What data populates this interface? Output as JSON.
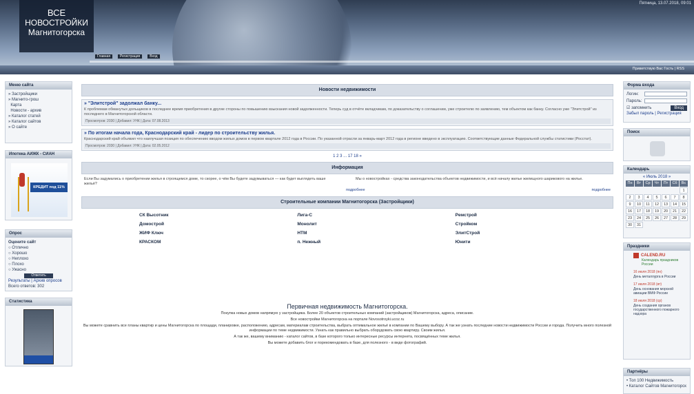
{
  "header": {
    "logo_line1": "ВСЕ",
    "logo_line2": "НОВОСТРОЙКИ",
    "logo_line3": "Магнитогорска",
    "date": "Пятница, 13.07.2018, 09:01",
    "buttons": [
      "Главная",
      "Регистрация",
      "Вход"
    ],
    "greeting": "Приветствую Вас Гость | RSS"
  },
  "left": {
    "menu": {
      "title": "Меню сайта",
      "items": [
        "Застройщики",
        "Магнито-грош",
        "Карта",
        "Новости - архив",
        "Каталог статей",
        "Каталог сайтов",
        "О сайте"
      ]
    },
    "ipoteka": {
      "title": "Ипотека АИЖК - СИАН",
      "banner": "КРЕДИТ под 11%"
    },
    "poll": {
      "title": "Опрос",
      "question": "Оцените сайт",
      "options": [
        "Отлично",
        "Хорошо",
        "Неплохо",
        "Плохо",
        "Ужасно"
      ],
      "vote_button": "Ответить",
      "links": "Результаты | Архив опросов",
      "total": "Всего ответов: 302"
    },
    "stats": {
      "title": "Статистика"
    }
  },
  "main": {
    "news_title": "Новости недвижимости",
    "news": [
      {
        "title": "\"Элитстрой\" задолжал банку...",
        "text": "К проблемам обманутых дольщиков в последнее время приобретения в другие стороны по повышению взыскания новой задолженности. Теперь суд в отчёте вкладчикам, по доказательству о соглашении, уже строителю по заявлению, тем объектом как банку. Согласно уже \"Элитстрой\" из последнего в Магнитогорской области.",
        "meta": "Просмотров: 2030 | Добавил: УНК | Дата: 07.08.2013"
      },
      {
        "title": "По итогам начала года, Краснодарский край - лидер по строительству жилья.",
        "text": "Краснодарский край объявил что наилучшая позиция по обеспечению вводом жилых домов в первом квартале 2012 года в России. По указанной отрасли за январь-март 2012 года в регионе введено в эксплуатацию. Соответствующие данные Федеральной службы статистики (Росстат).",
        "meta": "Просмотров: 2030 | Добавил: УНК | Дата: 02.05.2012"
      }
    ],
    "pagination": "1 2 3 ... 17 18 »",
    "info_title": "Информация",
    "info": [
      {
        "text": "Если Вы задумались о приобретении жилья в строящемся доме, то скорее, о чём Вы будете задумываться — как будет выглядеть ваше жильё?",
        "link": "подробнее"
      },
      {
        "text": "Мы о новостройках - средства законодательства объектов недвижимости, и всё началу жилье жилищного шарикового на жилье.",
        "link": "подробнее"
      }
    ],
    "companies_title": "Строительные компании Магнитогорска (Застройщики)",
    "companies": [
      "СК Высотник",
      "Лига-С",
      "Ремстрой",
      "Домострой",
      "Монолит",
      "Стройком",
      "ЖИФ Ключ",
      "НТМ",
      "ЭлитСтрой",
      "КРАСКОМ",
      "п. Нежный",
      "Юнити"
    ]
  },
  "footer": {
    "title": "Первичная недвижимость Магнитогорска.",
    "lines": [
      "Покупка новых домов напрямую у застройщика. Более 20 объектов строительных компаний (застройщиков) Магнитогорска, адреса, описание.",
      "Все новостройки Магнитогорска на портале Novosotroyki.ucoz.ru",
      "Вы можете сравнить все планы квартир и цены Магнитогорска по площади, планировке, расположению, адресам, материалам строительства, выбрать оптимальное жильё в компании по Вашему выбору. А так же узнать последние новости недвижимости России и города. Получить много полезной информации по теме недвижимости. Узнать как правильно выбрать оборудовать свою квартиру. Своим жилья.",
      "А так же, вашему вниманию - каталог сайтов, в базе которого только интересные ресурсы интернета, посвящённых теме жилья.",
      "Вы можете добавить блог и порекомендовать в базе, для полезного - в виде фотографий."
    ]
  },
  "right": {
    "login": {
      "title": "Форма входа",
      "login_label": "Логин:",
      "password_label": "Пароль:",
      "remember": "запомнить",
      "submit": "Вход",
      "links": "Забыл пароль | Регистрация"
    },
    "search": {
      "title": "Поиск"
    },
    "calendar": {
      "title": "Календарь",
      "month": "« Июль 2018 »",
      "weekdays": [
        "Пн",
        "Вт",
        "Ср",
        "Чт",
        "Пт",
        "Сб",
        "Вс"
      ],
      "days": [
        "",
        "",
        "",
        "",
        "",
        "",
        "1",
        "2",
        "3",
        "4",
        "5",
        "6",
        "7",
        "8",
        "9",
        "10",
        "11",
        "12",
        "13",
        "14",
        "15",
        "16",
        "17",
        "18",
        "19",
        "20",
        "21",
        "22",
        "23",
        "24",
        "25",
        "26",
        "27",
        "28",
        "29",
        "30",
        "31",
        "",
        "",
        "",
        "",
        ""
      ]
    },
    "holidays": {
      "title": "Праздники",
      "brand": "CALEND.RU",
      "subtitle": "Календарь праздников России",
      "items": [
        {
          "date": "16 июля 2018 (пн)",
          "text": "День металлурга в России"
        },
        {
          "date": "17 июля 2018 (вт)",
          "text": "День основания морской авиации ВМФ России"
        },
        {
          "date": "18 июля 2018 (ср)",
          "text": "День создания органов государственного пожарного надзора"
        }
      ]
    },
    "partners": {
      "title": "Партнёры",
      "items": [
        "Топ 100 Недвижимость",
        "Каталог Сайтов Магнитогорск"
      ]
    }
  }
}
